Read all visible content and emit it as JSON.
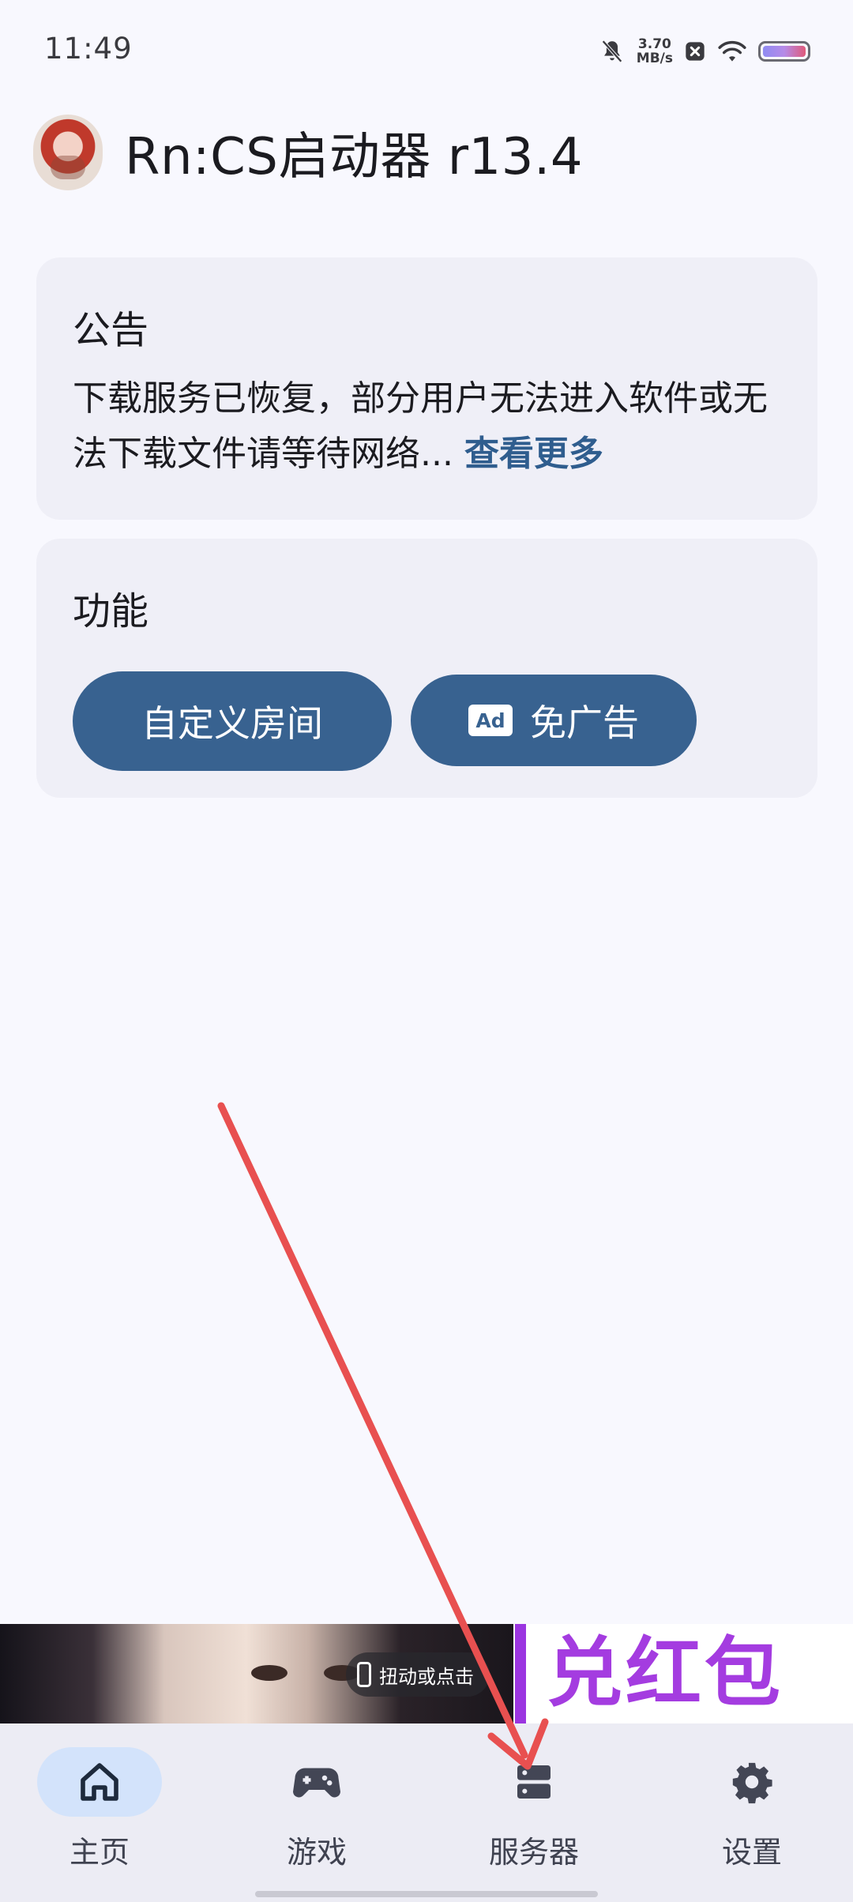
{
  "status_bar": {
    "time": "11:49",
    "net_speed_value": "3.70",
    "net_speed_unit": "MB/s",
    "icons": [
      "mute-bell-icon",
      "close-box-icon",
      "wifi-icon",
      "battery-icon"
    ]
  },
  "header": {
    "title": "Rn:CS启动器 r13.4"
  },
  "notice": {
    "title": "公告",
    "body": "下载服务已恢复，部分用户无法进入软件或无法下载文件请等待网络...",
    "more_label": "查看更多"
  },
  "features": {
    "title": "功能",
    "buttons": [
      {
        "label": "自定义房间"
      },
      {
        "label": "免广告",
        "icon": "Ad"
      }
    ]
  },
  "ad_banner": {
    "chip_label": "扭动或点击",
    "headline": "兑红包"
  },
  "bottom_nav": {
    "items": [
      {
        "label": "主页",
        "icon": "home-icon",
        "active": true
      },
      {
        "label": "游戏",
        "icon": "gamepad-icon",
        "active": false
      },
      {
        "label": "服务器",
        "icon": "server-icon",
        "active": false
      },
      {
        "label": "设置",
        "icon": "gear-icon",
        "active": false
      }
    ]
  },
  "colors": {
    "background": "#f8f8fe",
    "card": "#efeff7",
    "primary_button": "#386290",
    "link": "#2f5d8e",
    "active_nav": "#d3e3fb",
    "annotation_arrow": "#e85050",
    "ad_purple": "#a43ce0"
  }
}
